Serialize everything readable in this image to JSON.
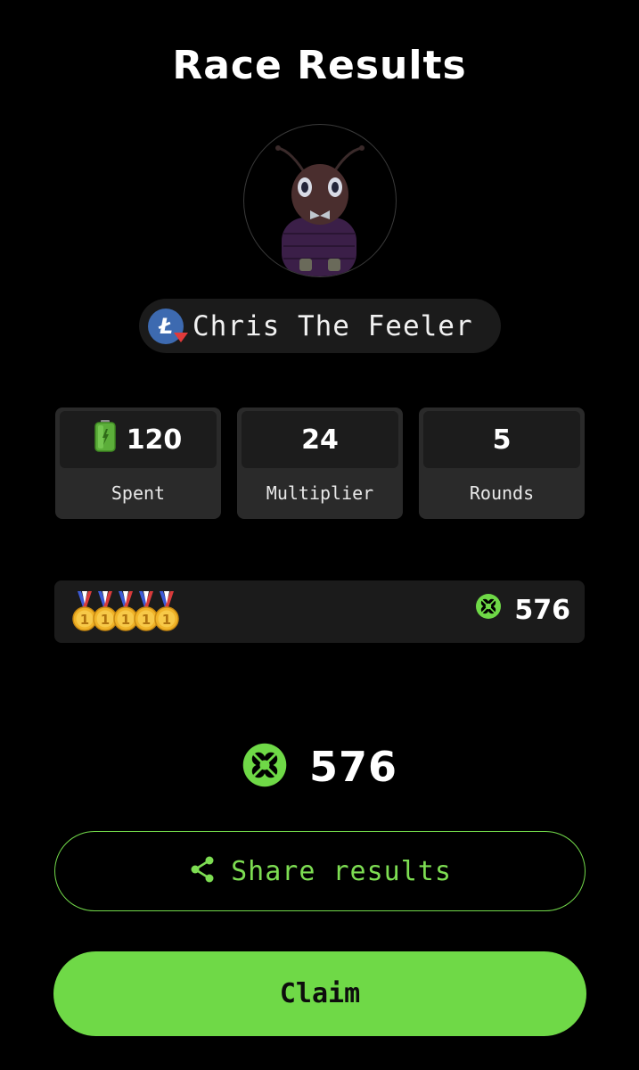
{
  "page": {
    "title": "Race Results"
  },
  "racer": {
    "name": "Chris The Feeler",
    "currency_badge": "Ł",
    "avatar": "bug-character-avatar"
  },
  "stats": [
    {
      "value": "120",
      "label": "Spent",
      "icon": "battery-icon"
    },
    {
      "value": "24",
      "label": "Multiplier"
    },
    {
      "value": "5",
      "label": "Rounds"
    }
  ],
  "rewards_row": {
    "medal_count": 5,
    "medal_icon": "gold-medal-icon",
    "medal_digit": "1",
    "score": "576",
    "score_icon": "green-coin-icon"
  },
  "total": {
    "value": "576",
    "icon": "green-coin-icon"
  },
  "buttons": {
    "share_label": "Share results",
    "claim_label": "Claim"
  },
  "colors": {
    "background": "#000000",
    "accent_green": "#6fd947",
    "card": "#2a2a2a",
    "card_inner": "#1c1c1c",
    "pill": "#1b1b1b",
    "ltc_blue": "#3d6ab0",
    "ltc_arrow_red": "#e03a3a"
  }
}
